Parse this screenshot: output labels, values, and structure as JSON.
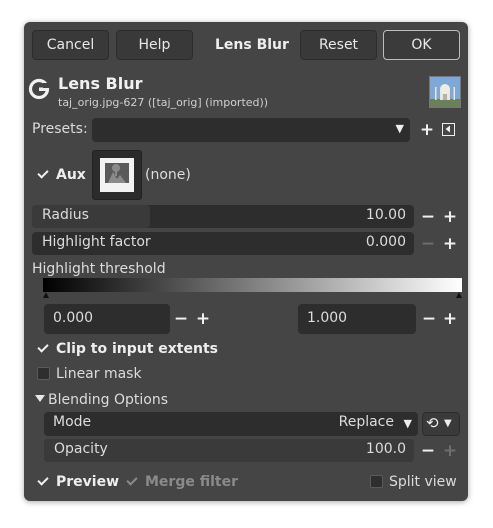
{
  "header": {
    "cancel_label": "Cancel",
    "help_label": "Help",
    "title": "Lens Blur",
    "reset_label": "Reset",
    "ok_label": "OK"
  },
  "filter": {
    "name": "Lens Blur",
    "source": "taj_orig.jpg-627 ([taj_orig] (imported))"
  },
  "presets": {
    "label": "Presets:",
    "value": ""
  },
  "aux": {
    "label": "Aux",
    "checked": true,
    "value": "(none)"
  },
  "radius": {
    "label": "Radius",
    "value": "10.00",
    "fill": 0.31
  },
  "highlight_factor": {
    "label": "Highlight factor",
    "value": "0.000",
    "fill": 0.0
  },
  "highlight_threshold": {
    "label": "Highlight threshold",
    "low_value": "0.000",
    "high_value": "1.000"
  },
  "clip": {
    "label": "Clip to input extents",
    "checked": true
  },
  "linear_mask": {
    "label": "Linear mask",
    "checked": false
  },
  "blending": {
    "section_label": "Blending Options",
    "mode_label": "Mode",
    "mode_value": "Replace",
    "opacity_label": "Opacity",
    "opacity_value": "100.0",
    "opacity_fill": 1.0
  },
  "footer": {
    "preview_label": "Preview",
    "preview_checked": true,
    "merge_label": "Merge filter",
    "merge_checked": true,
    "split_label": "Split view",
    "split_checked": false
  },
  "colors": {
    "dialog_bg": "#454545",
    "field_bg": "#2d2d2d",
    "slider_fill": "#3a3a3a",
    "text": "#dcdcdc"
  }
}
